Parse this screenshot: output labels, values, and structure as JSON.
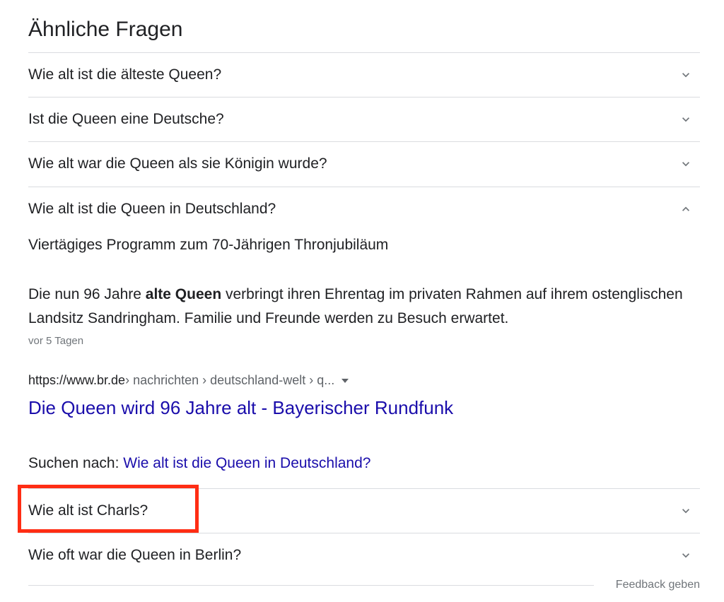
{
  "heading": "Ähnliche Fragen",
  "questions": [
    {
      "text": "Wie alt ist die älteste Queen?",
      "expanded": false,
      "icon": "chevron-down-icon"
    },
    {
      "text": "Ist die Queen eine Deutsche?",
      "expanded": false,
      "icon": "chevron-down-icon"
    },
    {
      "text": "Wie alt war die Queen als sie Königin wurde?",
      "expanded": false,
      "icon": "chevron-down-icon"
    },
    {
      "text": "Wie alt ist die Queen in Deutschland?",
      "expanded": true,
      "icon": "chevron-up-icon"
    },
    {
      "text": "Wie alt ist Charls?",
      "expanded": false,
      "icon": "chevron-down-icon",
      "highlighted": true
    },
    {
      "text": "Wie oft war die Queen in Berlin?",
      "expanded": false,
      "icon": "chevron-down-icon"
    }
  ],
  "answer": {
    "title": "Viertägiges Programm zum 70-Jährigen Thronjubiläum",
    "body_before": "Die nun 96 Jahre ",
    "body_bold": "alte Queen",
    "body_after": " verbringt ihren Ehrentag im privaten Rahmen auf ihrem ostenglischen Landsitz Sandringham. Familie und Freunde werden zu Besuch erwartet.",
    "date": "vor 5 Tagen",
    "cite_domain": "https://www.br.de",
    "cite_path": " › nachrichten › deutschland-welt › q...",
    "link_title": "Die Queen wird 96 Jahre alt - Bayerischer Rundfunk",
    "search_label": "Suchen nach: ",
    "search_query": "Wie alt ist die Queen in Deutschland?"
  },
  "feedback": "Feedback geben",
  "colors": {
    "link": "#1a0dab",
    "highlight": "#ff2d14",
    "divider": "#dadce0"
  }
}
